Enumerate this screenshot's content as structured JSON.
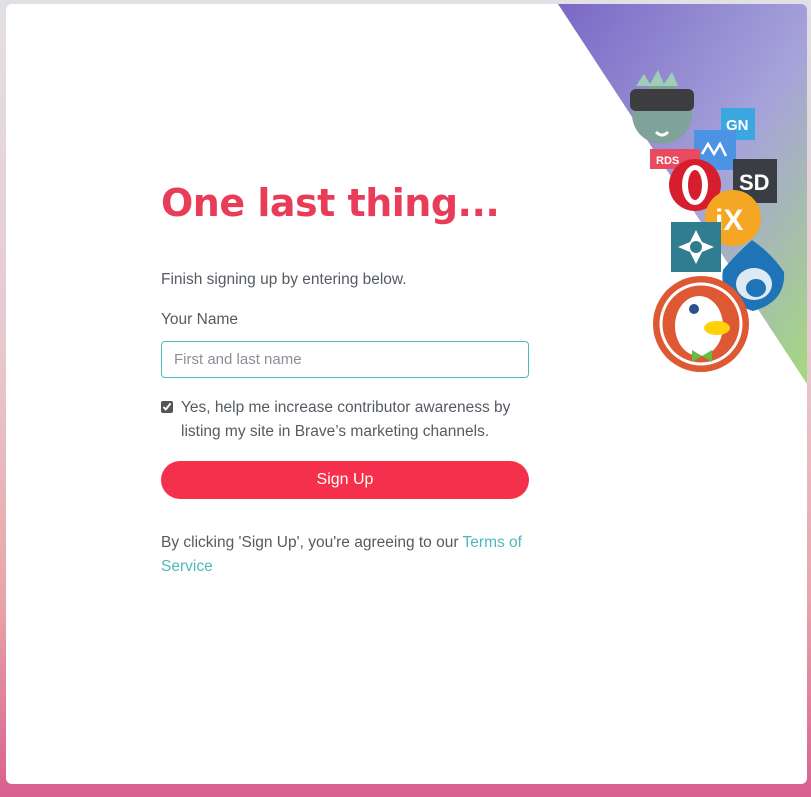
{
  "page": {
    "title": "One last thing...",
    "intro": "Finish signing up by entering below."
  },
  "form": {
    "name_label": "Your Name",
    "name_placeholder": "First and last name",
    "name_value": "",
    "checkbox_checked": true,
    "checkbox_text": "Yes, help me increase contributor awareness by listing my site in Brave’s marketing channels.",
    "submit_label": "Sign Up"
  },
  "terms": {
    "prefix": "By clicking 'Sign Up', you're agreeing to our ",
    "link_label": "Terms of Service"
  },
  "art": {
    "icons": [
      "zombie-mascot-icon",
      "gn-logo-icon",
      "mj-logo-icon",
      "rds-logo-icon",
      "opera-style-logo-icon",
      "sd-logo-icon",
      "ix-logo-icon",
      "flower-logo-icon",
      "drupal-logo-icon",
      "duckduckgo-logo-icon"
    ],
    "gn_text": "GN",
    "sd_text": "SD",
    "ix_text": "iX",
    "rds_text": "RDS"
  },
  "colors": {
    "accent": "#e93c59",
    "button": "#f4304d",
    "link": "#4fb8bd",
    "text": "#555b62"
  }
}
